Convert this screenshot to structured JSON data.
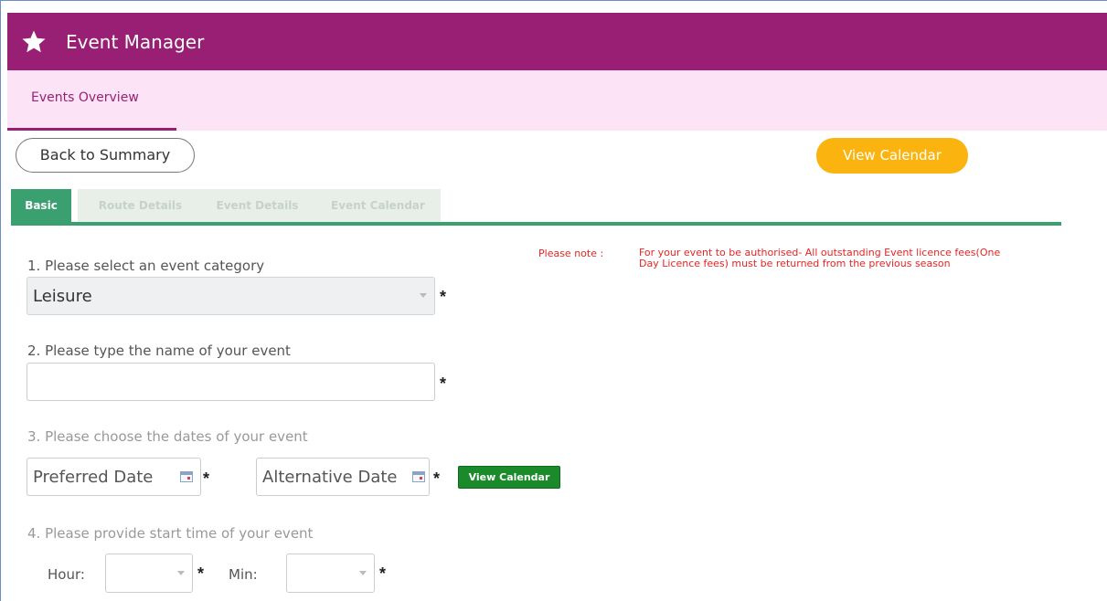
{
  "header": {
    "title": "Event Manager",
    "icon": "star-icon"
  },
  "subnav": {
    "tab_label": "Events Overview"
  },
  "actions": {
    "back_label": "Back to Summary",
    "view_calendar_label": "View Calendar"
  },
  "tabs": [
    {
      "label": "Basic",
      "active": true
    },
    {
      "label": "Route Details",
      "active": false
    },
    {
      "label": "Event Details",
      "active": false
    },
    {
      "label": "Event Calendar",
      "active": false
    }
  ],
  "form": {
    "q1_label": "1. Please select an event category",
    "q1_value": "Leisure",
    "q2_label": "2. Please type the name of your event",
    "q2_value": "",
    "q3_label": "3. Please choose the dates of your event",
    "preferred_date_placeholder": "Preferred Date",
    "alternative_date_placeholder": "Alternative Date",
    "view_calendar_small_label": "View Calendar",
    "q4_label": "4. Please provide start time of your event",
    "hour_label": "Hour:",
    "min_label": "Min:",
    "required_mark": "*"
  },
  "note": {
    "label": "Please note :",
    "text": "For your event to be authorised- All outstanding Event licence fees(One Day Licence fees) must be returned from the previous season"
  },
  "colors": {
    "header_bg": "#981f74",
    "subnav_bg": "#fde3f6",
    "tab_active": "#3aa070",
    "calendar_button": "#fbb40f",
    "small_calendar_button": "#1a8a2b",
    "note_text": "#e52525"
  }
}
